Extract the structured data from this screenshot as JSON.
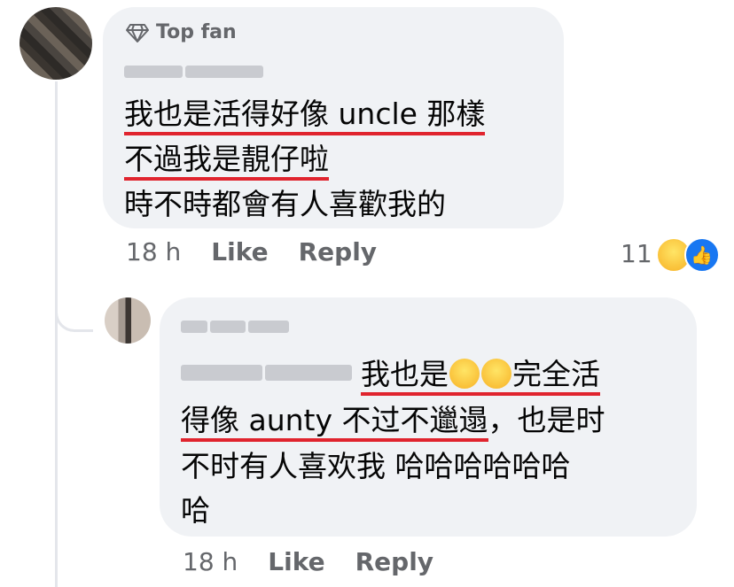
{
  "top_comment": {
    "badge": "Top fan",
    "lines": [
      "我也是活得好像 uncle 那樣",
      "不過我是靚仔啦",
      "時不時都會有人喜歡我的"
    ],
    "time": "18 h",
    "like_label": "Like",
    "reply_label": "Reply",
    "reaction_count": "11",
    "reaction_icons": [
      "haha-icon",
      "like-icon"
    ]
  },
  "reply_comment": {
    "line1_text": "我也是",
    "line1_emoji": [
      "rofl-emoji",
      "rofl-emoji"
    ],
    "line1_tail": "完全活",
    "line2_underlined": "得像 aunty 不过不邋遢",
    "line2_rest": "，也是时",
    "line3": "不时有人喜欢我 哈哈哈哈哈哈",
    "line4": "哈",
    "time": "18 h",
    "like_label": "Like",
    "reply_label": "Reply"
  },
  "colors": {
    "bubble": "#f0f2f5",
    "meta": "#65676b",
    "underline": "#e0242e",
    "like_blue": "#1877f2"
  }
}
